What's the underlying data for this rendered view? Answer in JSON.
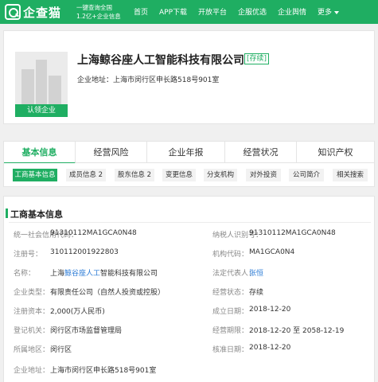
{
  "brand": {
    "logo_text": "企查猫",
    "slogan_line1": "一键查询全国",
    "slogan_line2": "1.2亿+企业信息"
  },
  "nav": {
    "items": [
      "首页",
      "APP下载",
      "开放平台",
      "企服优选",
      "企业舆情"
    ],
    "more": "更多"
  },
  "company": {
    "name": "上海鲸谷座人工智能科技有限公司",
    "status": "[存续]",
    "address_label": "企业地址：",
    "address": "上海市闵行区申长路518号901室",
    "claim_button": "认领企业"
  },
  "tabs": [
    "基本信息",
    "经营风险",
    "企业年报",
    "经营状况",
    "知识产权"
  ],
  "subtabs": [
    "工商基本信息",
    "成员信息 2",
    "股东信息 2",
    "变更信息",
    "分支机构",
    "对外投资",
    "公司简介",
    "相关搜索"
  ],
  "info": {
    "title": "工商基本信息",
    "credit_code_label": "统一社会信用代码：",
    "credit_code": "91310112MA1GCA0N48",
    "taxpayer_id_label": "纳税人识别号：",
    "taxpayer_id": "91310112MA1GCA0N48",
    "reg_no_label": "注册号：",
    "reg_no": "310112001922803",
    "org_code_label": "机构代码：",
    "org_code": "MA1GCA0N4",
    "name_label": "名称：",
    "name_pre": "上海",
    "name_hl": "鲸谷座人工",
    "name_post": "智能科技有限公司",
    "legal_rep_label": "法定代表人：",
    "legal_rep": "张恒",
    "type_label": "企业类型：",
    "type": "有限责任公司（自然人投资或控股）",
    "op_status_label": "经营状态：",
    "op_status": "存续",
    "capital_label": "注册资本：",
    "capital": "2,000(万人民币)",
    "founded_label": "成立日期：",
    "founded": "2018-12-20",
    "authority_label": "登记机关：",
    "authority": "闵行区市场监督管理局",
    "term_label": "经营期限：",
    "term": "2018-12-20 至 2058-12-19",
    "region_label": "所属地区：",
    "region": "闵行区",
    "approval_label": "核准日期：",
    "approval": "2018-12-20",
    "address_label": "企业地址：",
    "address": "上海市闵行区申长路518号901室"
  }
}
